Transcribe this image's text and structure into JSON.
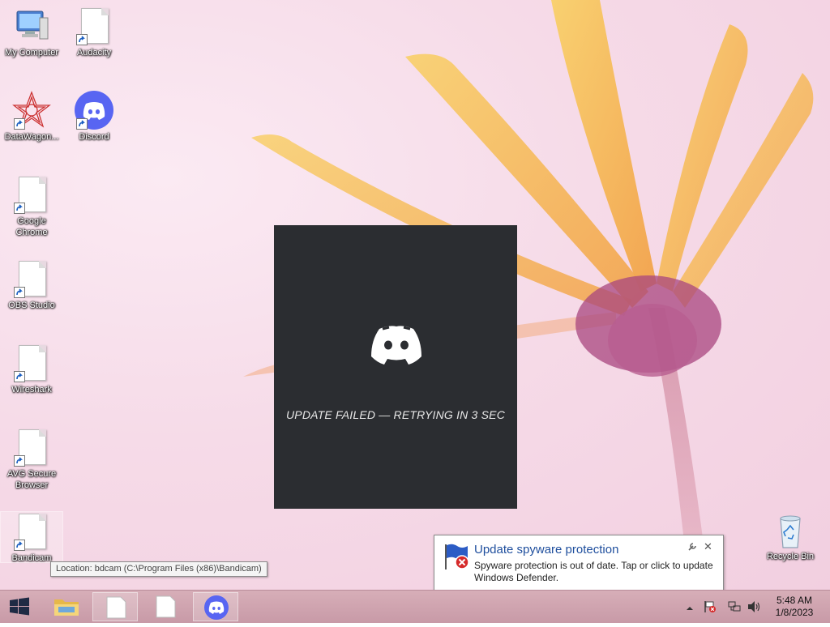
{
  "desktop_icons": [
    {
      "label": "My Computer"
    },
    {
      "label": "Audacity"
    },
    {
      "label": "DataWagon..."
    },
    {
      "label": "Discord"
    },
    {
      "label": "Google Chrome"
    },
    {
      "label": "OBS Studio"
    },
    {
      "label": "Wireshark"
    },
    {
      "label": "AVG Secure Browser"
    },
    {
      "label": "Bandicam"
    },
    {
      "label": "Recycle Bin"
    }
  ],
  "splash": {
    "message": "UPDATE FAILED — RETRYING IN 3 SEC"
  },
  "tooltip": {
    "text": "Location: bdcam (C:\\Program Files (x86)\\Bandicam)"
  },
  "notification": {
    "title": "Update spyware protection",
    "body": "Spyware protection is out of date. Tap or click to update Windows Defender.",
    "close": "✕"
  },
  "clock": {
    "time": "5:48 AM",
    "date": "1/8/2023"
  },
  "colors": {
    "splash_bg": "#2b2d31",
    "discord_blurple": "#5865f2",
    "notification_title": "#1e4e9d"
  }
}
